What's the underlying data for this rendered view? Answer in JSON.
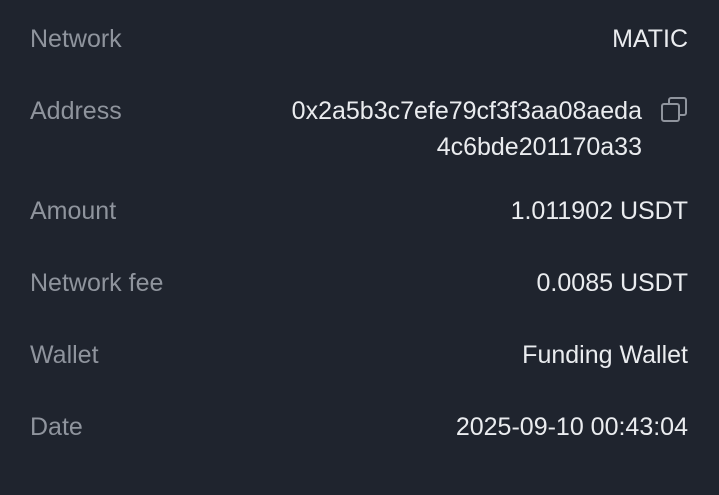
{
  "rows": [
    {
      "label": "Network",
      "value": "MATIC"
    },
    {
      "label": "Address",
      "value_line1": "0x2a5b3c7efe79cf3f3aa08aeda",
      "value_line2": "4c6bde201170a33"
    },
    {
      "label": "Amount",
      "value": "1.011902 USDT"
    },
    {
      "label": "Network fee",
      "value": "0.0085 USDT"
    },
    {
      "label": "Wallet",
      "value": "Funding Wallet"
    },
    {
      "label": "Date",
      "value": "2025-09-10 00:43:04"
    }
  ],
  "icons": {
    "copy": "copy-icon"
  },
  "colors": {
    "background": "#1f242e",
    "label": "#8f949d",
    "value": "#eaecef"
  }
}
